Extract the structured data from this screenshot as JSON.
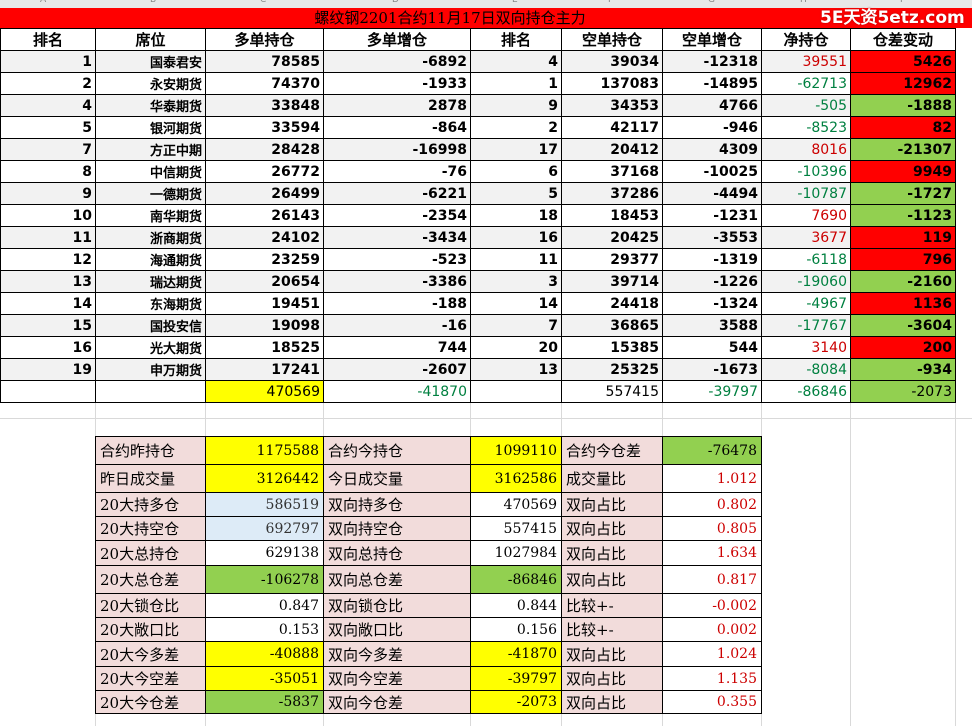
{
  "title": "螺纹钢2201合约11月17日双向持仓主力",
  "watermark": "5E天资5etz.com",
  "column_letters": [
    "A",
    "B",
    "C",
    "D",
    "E",
    "F",
    "G",
    "H",
    "I"
  ],
  "headers": [
    "排名",
    "席位",
    "多单持仓",
    "多单增仓",
    "排名",
    "空单持仓",
    "空单增仓",
    "净持仓",
    "仓差变动"
  ],
  "rows": [
    {
      "rank": "1",
      "seat": "国泰君安",
      "long": "78585",
      "long_chg": "-6892",
      "srank": "4",
      "short": "39034",
      "short_chg": "-12318",
      "net": "39551",
      "diff": "5426"
    },
    {
      "rank": "2",
      "seat": "永安期货",
      "long": "74370",
      "long_chg": "-1933",
      "srank": "1",
      "short": "137083",
      "short_chg": "-14895",
      "net": "-62713",
      "diff": "12962"
    },
    {
      "rank": "4",
      "seat": "华泰期货",
      "long": "33848",
      "long_chg": "2878",
      "srank": "9",
      "short": "34353",
      "short_chg": "4766",
      "net": "-505",
      "diff": "-1888"
    },
    {
      "rank": "5",
      "seat": "银河期货",
      "long": "33594",
      "long_chg": "-864",
      "srank": "2",
      "short": "42117",
      "short_chg": "-946",
      "net": "-8523",
      "diff": "82"
    },
    {
      "rank": "7",
      "seat": "方正中期",
      "long": "28428",
      "long_chg": "-16998",
      "srank": "17",
      "short": "20412",
      "short_chg": "4309",
      "net": "8016",
      "diff": "-21307"
    },
    {
      "rank": "8",
      "seat": "中信期货",
      "long": "26772",
      "long_chg": "-76",
      "srank": "6",
      "short": "37168",
      "short_chg": "-10025",
      "net": "-10396",
      "diff": "9949"
    },
    {
      "rank": "9",
      "seat": "一德期货",
      "long": "26499",
      "long_chg": "-6221",
      "srank": "5",
      "short": "37286",
      "short_chg": "-4494",
      "net": "-10787",
      "diff": "-1727"
    },
    {
      "rank": "10",
      "seat": "南华期货",
      "long": "26143",
      "long_chg": "-2354",
      "srank": "18",
      "short": "18453",
      "short_chg": "-1231",
      "net": "7690",
      "diff": "-1123"
    },
    {
      "rank": "11",
      "seat": "浙商期货",
      "long": "24102",
      "long_chg": "-3434",
      "srank": "16",
      "short": "20425",
      "short_chg": "-3553",
      "net": "3677",
      "diff": "119"
    },
    {
      "rank": "12",
      "seat": "海通期货",
      "long": "23259",
      "long_chg": "-523",
      "srank": "11",
      "short": "29377",
      "short_chg": "-1319",
      "net": "-6118",
      "diff": "796"
    },
    {
      "rank": "13",
      "seat": "瑞达期货",
      "long": "20654",
      "long_chg": "-3386",
      "srank": "3",
      "short": "39714",
      "short_chg": "-1226",
      "net": "-19060",
      "diff": "-2160"
    },
    {
      "rank": "14",
      "seat": "东海期货",
      "long": "19451",
      "long_chg": "-188",
      "srank": "14",
      "short": "24418",
      "short_chg": "-1324",
      "net": "-4967",
      "diff": "1136"
    },
    {
      "rank": "15",
      "seat": "国投安信",
      "long": "19098",
      "long_chg": "-16",
      "srank": "7",
      "short": "36865",
      "short_chg": "3588",
      "net": "-17767",
      "diff": "-3604"
    },
    {
      "rank": "16",
      "seat": "光大期货",
      "long": "18525",
      "long_chg": "744",
      "srank": "20",
      "short": "15385",
      "short_chg": "544",
      "net": "3140",
      "diff": "200"
    },
    {
      "rank": "19",
      "seat": "申万期货",
      "long": "17241",
      "long_chg": "-2607",
      "srank": "13",
      "short": "25325",
      "short_chg": "-1673",
      "net": "-8084",
      "diff": "-934"
    }
  ],
  "totals": {
    "long": "470569",
    "long_chg": "-41870",
    "short": "557415",
    "short_chg": "-39797",
    "net": "-86846",
    "diff": "-2073"
  },
  "summary": [
    {
      "l1": "合约昨持仓",
      "v1": "1175588",
      "l2": "合约今持仓",
      "v2": "1099110",
      "l3": "合约今仓差",
      "v3": "-76478"
    },
    {
      "l1": "昨日成交量",
      "v1": "3126442",
      "l2": "今日成交量",
      "v2": "3162586",
      "l3": "成交量比",
      "v3": "1.012"
    },
    {
      "l1": "20大持多仓",
      "v1": "586519",
      "l2": "双向持多仓",
      "v2": "470569",
      "l3": "双向占比",
      "v3": "0.802"
    },
    {
      "l1": "20大持空仓",
      "v1": "692797",
      "l2": "双向持空仓",
      "v2": "557415",
      "l3": "双向占比",
      "v3": "0.805"
    },
    {
      "l1": "20大总持仓",
      "v1": "629138",
      "l2": "双向总持仓",
      "v2": "1027984",
      "l3": "双向占比",
      "v3": "1.634"
    },
    {
      "l1": "20大总仓差",
      "v1": "-106278",
      "l2": "双向总仓差",
      "v2": "-86846",
      "l3": "双向占比",
      "v3": "0.817"
    },
    {
      "l1": "20大锁仓比",
      "v1": "0.847",
      "l2": "双向锁仓比",
      "v2": "0.844",
      "l3": "比较+-",
      "v3": "-0.002"
    },
    {
      "l1": "20大敞口比",
      "v1": "0.153",
      "l2": "双向敞口比",
      "v2": "0.156",
      "l3": "比较+-",
      "v3": "0.002"
    },
    {
      "l1": "20大今多差",
      "v1": "-40888",
      "l2": "双向今多差",
      "v2": "-41870",
      "l3": "双向占比",
      "v3": "1.024"
    },
    {
      "l1": "20大今空差",
      "v1": "-35051",
      "l2": "双向今空差",
      "v2": "-39797",
      "l3": "双向占比",
      "v3": "1.135"
    },
    {
      "l1": "20大今仓差",
      "v1": "-5837",
      "l2": "双向今仓差",
      "v2": "-2073",
      "l3": "双向占比",
      "v3": "0.355"
    }
  ],
  "colors": {
    "red": "#ff0000",
    "green": "#92d050",
    "yellow": "#ffff00",
    "pink": "#f2dcdb",
    "lightblue": "#ddebf7",
    "text_red": "#cc0000",
    "text_green": "#008040"
  }
}
